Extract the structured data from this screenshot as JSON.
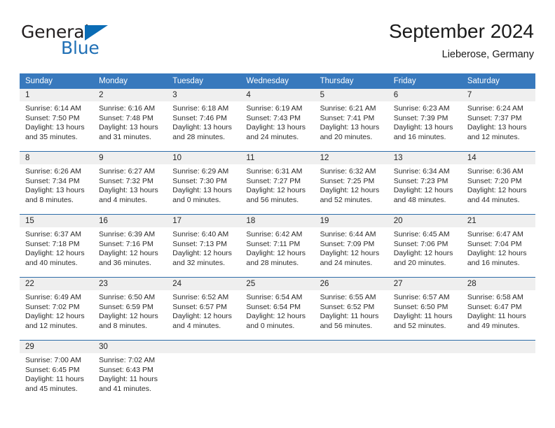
{
  "brand": {
    "name_top": "General",
    "name_bottom": "Blue",
    "color_top": "#231f20",
    "color_bottom": "#1f6fb5",
    "triangle_color": "#0b6cb5"
  },
  "header": {
    "title": "September 2024",
    "subtitle": "Lieberose, Germany"
  },
  "theme": {
    "header_bg": "#3879bd",
    "daynum_bg": "#efefef",
    "row_divider": "#2d6ca8",
    "text": "#232323"
  },
  "weekdays": [
    "Sunday",
    "Monday",
    "Tuesday",
    "Wednesday",
    "Thursday",
    "Friday",
    "Saturday"
  ],
  "weeks": [
    [
      {
        "day": "1",
        "sunrise": "Sunrise: 6:14 AM",
        "sunset": "Sunset: 7:50 PM",
        "daylight1": "Daylight: 13 hours",
        "daylight2": "and 35 minutes."
      },
      {
        "day": "2",
        "sunrise": "Sunrise: 6:16 AM",
        "sunset": "Sunset: 7:48 PM",
        "daylight1": "Daylight: 13 hours",
        "daylight2": "and 31 minutes."
      },
      {
        "day": "3",
        "sunrise": "Sunrise: 6:18 AM",
        "sunset": "Sunset: 7:46 PM",
        "daylight1": "Daylight: 13 hours",
        "daylight2": "and 28 minutes."
      },
      {
        "day": "4",
        "sunrise": "Sunrise: 6:19 AM",
        "sunset": "Sunset: 7:43 PM",
        "daylight1": "Daylight: 13 hours",
        "daylight2": "and 24 minutes."
      },
      {
        "day": "5",
        "sunrise": "Sunrise: 6:21 AM",
        "sunset": "Sunset: 7:41 PM",
        "daylight1": "Daylight: 13 hours",
        "daylight2": "and 20 minutes."
      },
      {
        "day": "6",
        "sunrise": "Sunrise: 6:23 AM",
        "sunset": "Sunset: 7:39 PM",
        "daylight1": "Daylight: 13 hours",
        "daylight2": "and 16 minutes."
      },
      {
        "day": "7",
        "sunrise": "Sunrise: 6:24 AM",
        "sunset": "Sunset: 7:37 PM",
        "daylight1": "Daylight: 13 hours",
        "daylight2": "and 12 minutes."
      }
    ],
    [
      {
        "day": "8",
        "sunrise": "Sunrise: 6:26 AM",
        "sunset": "Sunset: 7:34 PM",
        "daylight1": "Daylight: 13 hours",
        "daylight2": "and 8 minutes."
      },
      {
        "day": "9",
        "sunrise": "Sunrise: 6:27 AM",
        "sunset": "Sunset: 7:32 PM",
        "daylight1": "Daylight: 13 hours",
        "daylight2": "and 4 minutes."
      },
      {
        "day": "10",
        "sunrise": "Sunrise: 6:29 AM",
        "sunset": "Sunset: 7:30 PM",
        "daylight1": "Daylight: 13 hours",
        "daylight2": "and 0 minutes."
      },
      {
        "day": "11",
        "sunrise": "Sunrise: 6:31 AM",
        "sunset": "Sunset: 7:27 PM",
        "daylight1": "Daylight: 12 hours",
        "daylight2": "and 56 minutes."
      },
      {
        "day": "12",
        "sunrise": "Sunrise: 6:32 AM",
        "sunset": "Sunset: 7:25 PM",
        "daylight1": "Daylight: 12 hours",
        "daylight2": "and 52 minutes."
      },
      {
        "day": "13",
        "sunrise": "Sunrise: 6:34 AM",
        "sunset": "Sunset: 7:23 PM",
        "daylight1": "Daylight: 12 hours",
        "daylight2": "and 48 minutes."
      },
      {
        "day": "14",
        "sunrise": "Sunrise: 6:36 AM",
        "sunset": "Sunset: 7:20 PM",
        "daylight1": "Daylight: 12 hours",
        "daylight2": "and 44 minutes."
      }
    ],
    [
      {
        "day": "15",
        "sunrise": "Sunrise: 6:37 AM",
        "sunset": "Sunset: 7:18 PM",
        "daylight1": "Daylight: 12 hours",
        "daylight2": "and 40 minutes."
      },
      {
        "day": "16",
        "sunrise": "Sunrise: 6:39 AM",
        "sunset": "Sunset: 7:16 PM",
        "daylight1": "Daylight: 12 hours",
        "daylight2": "and 36 minutes."
      },
      {
        "day": "17",
        "sunrise": "Sunrise: 6:40 AM",
        "sunset": "Sunset: 7:13 PM",
        "daylight1": "Daylight: 12 hours",
        "daylight2": "and 32 minutes."
      },
      {
        "day": "18",
        "sunrise": "Sunrise: 6:42 AM",
        "sunset": "Sunset: 7:11 PM",
        "daylight1": "Daylight: 12 hours",
        "daylight2": "and 28 minutes."
      },
      {
        "day": "19",
        "sunrise": "Sunrise: 6:44 AM",
        "sunset": "Sunset: 7:09 PM",
        "daylight1": "Daylight: 12 hours",
        "daylight2": "and 24 minutes."
      },
      {
        "day": "20",
        "sunrise": "Sunrise: 6:45 AM",
        "sunset": "Sunset: 7:06 PM",
        "daylight1": "Daylight: 12 hours",
        "daylight2": "and 20 minutes."
      },
      {
        "day": "21",
        "sunrise": "Sunrise: 6:47 AM",
        "sunset": "Sunset: 7:04 PM",
        "daylight1": "Daylight: 12 hours",
        "daylight2": "and 16 minutes."
      }
    ],
    [
      {
        "day": "22",
        "sunrise": "Sunrise: 6:49 AM",
        "sunset": "Sunset: 7:02 PM",
        "daylight1": "Daylight: 12 hours",
        "daylight2": "and 12 minutes."
      },
      {
        "day": "23",
        "sunrise": "Sunrise: 6:50 AM",
        "sunset": "Sunset: 6:59 PM",
        "daylight1": "Daylight: 12 hours",
        "daylight2": "and 8 minutes."
      },
      {
        "day": "24",
        "sunrise": "Sunrise: 6:52 AM",
        "sunset": "Sunset: 6:57 PM",
        "daylight1": "Daylight: 12 hours",
        "daylight2": "and 4 minutes."
      },
      {
        "day": "25",
        "sunrise": "Sunrise: 6:54 AM",
        "sunset": "Sunset: 6:54 PM",
        "daylight1": "Daylight: 12 hours",
        "daylight2": "and 0 minutes."
      },
      {
        "day": "26",
        "sunrise": "Sunrise: 6:55 AM",
        "sunset": "Sunset: 6:52 PM",
        "daylight1": "Daylight: 11 hours",
        "daylight2": "and 56 minutes."
      },
      {
        "day": "27",
        "sunrise": "Sunrise: 6:57 AM",
        "sunset": "Sunset: 6:50 PM",
        "daylight1": "Daylight: 11 hours",
        "daylight2": "and 52 minutes."
      },
      {
        "day": "28",
        "sunrise": "Sunrise: 6:58 AM",
        "sunset": "Sunset: 6:47 PM",
        "daylight1": "Daylight: 11 hours",
        "daylight2": "and 49 minutes."
      }
    ],
    [
      {
        "day": "29",
        "sunrise": "Sunrise: 7:00 AM",
        "sunset": "Sunset: 6:45 PM",
        "daylight1": "Daylight: 11 hours",
        "daylight2": "and 45 minutes."
      },
      {
        "day": "30",
        "sunrise": "Sunrise: 7:02 AM",
        "sunset": "Sunset: 6:43 PM",
        "daylight1": "Daylight: 11 hours",
        "daylight2": "and 41 minutes."
      },
      {
        "day": "",
        "sunrise": "",
        "sunset": "",
        "daylight1": "",
        "daylight2": ""
      },
      {
        "day": "",
        "sunrise": "",
        "sunset": "",
        "daylight1": "",
        "daylight2": ""
      },
      {
        "day": "",
        "sunrise": "",
        "sunset": "",
        "daylight1": "",
        "daylight2": ""
      },
      {
        "day": "",
        "sunrise": "",
        "sunset": "",
        "daylight1": "",
        "daylight2": ""
      },
      {
        "day": "",
        "sunrise": "",
        "sunset": "",
        "daylight1": "",
        "daylight2": ""
      }
    ]
  ]
}
